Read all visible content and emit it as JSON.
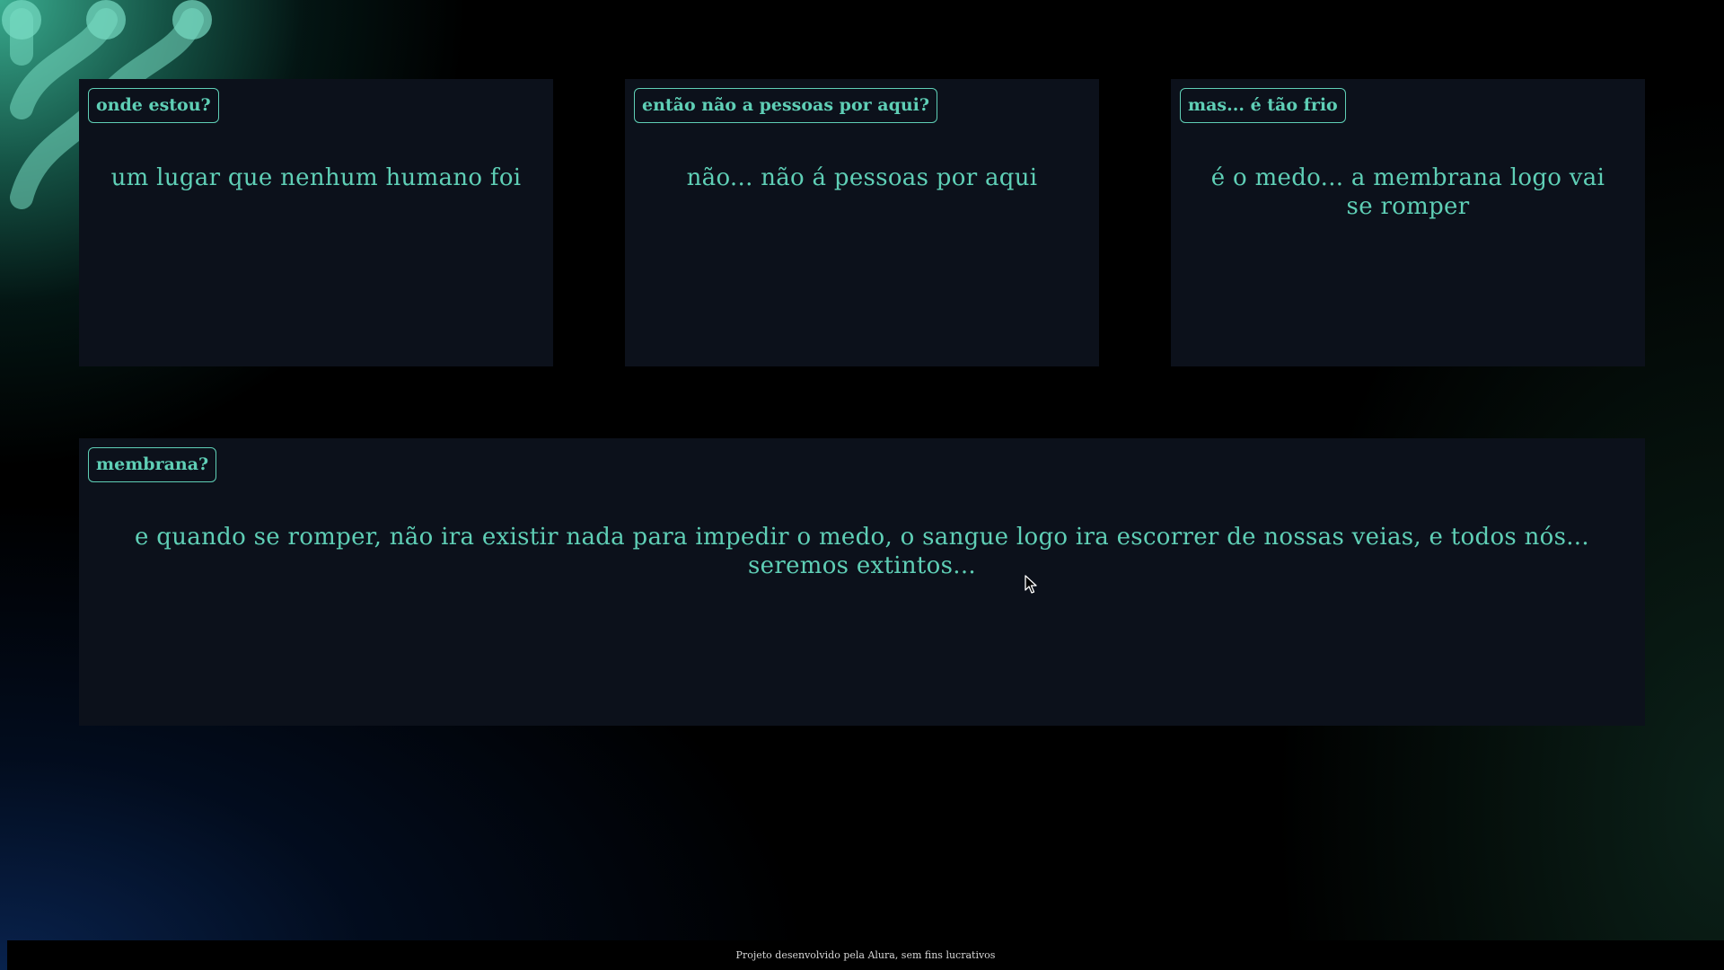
{
  "cards": [
    {
      "tag": "onde estou?",
      "text": "um lugar que nenhum humano foi"
    },
    {
      "tag": "então não a pessoas por aqui?",
      "text": "não... não á pessoas por aqui"
    },
    {
      "tag": "mas... é tão frio",
      "text": "é o medo... a membrana logo vai se romper"
    },
    {
      "tag": "membrana?",
      "text": "e quando se romper, não ira existir nada para impedir o medo, o sangue logo ira escorrer de nossas veias, e todos nós... seremos extintos..."
    }
  ],
  "footer": {
    "text": "Projeto desenvolvido pela Alura, sem fins lucrativos"
  },
  "colors": {
    "accent": "#5fcfb6",
    "card_bg": "#0c111b",
    "page_bg": "#000000"
  },
  "icons": {
    "decoration": "molecule-pattern-icon",
    "cursor": "mouse-pointer-icon"
  }
}
